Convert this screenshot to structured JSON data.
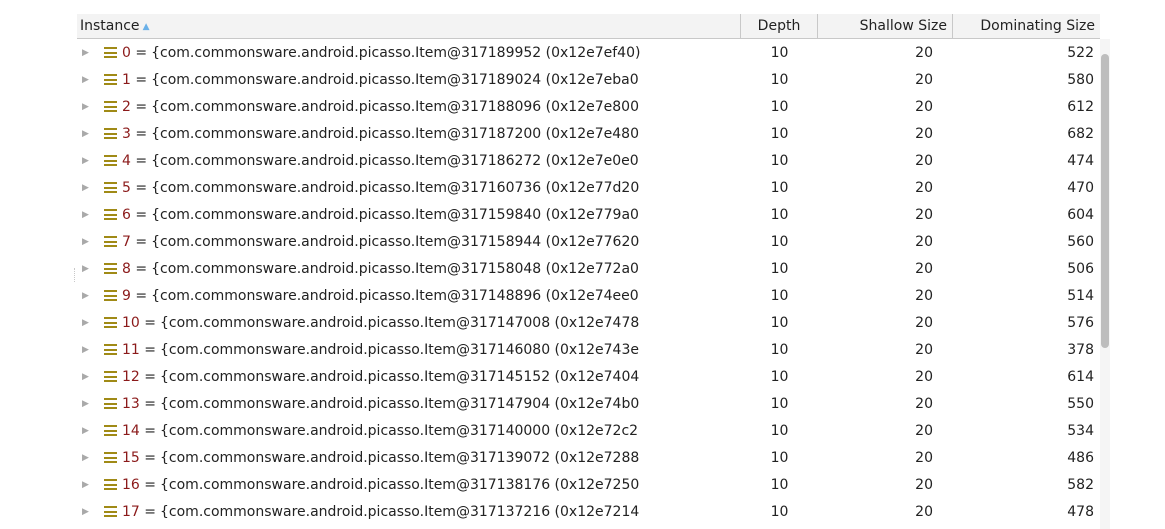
{
  "table": {
    "columns": {
      "instance": "Instance",
      "depth": "Depth",
      "shallow": "Shallow Size",
      "dominating": "Dominating Size"
    },
    "sort_indicator": "▲",
    "rows": [
      {
        "index": "0",
        "value": "{com.commonsware.android.picasso.Item@317189952 (0x12e7ef40)",
        "depth": "10",
        "shallow": "20",
        "dominating": "522"
      },
      {
        "index": "1",
        "value": "{com.commonsware.android.picasso.Item@317189024 (0x12e7eba0",
        "depth": "10",
        "shallow": "20",
        "dominating": "580"
      },
      {
        "index": "2",
        "value": "{com.commonsware.android.picasso.Item@317188096 (0x12e7e800",
        "depth": "10",
        "shallow": "20",
        "dominating": "612"
      },
      {
        "index": "3",
        "value": "{com.commonsware.android.picasso.Item@317187200 (0x12e7e480",
        "depth": "10",
        "shallow": "20",
        "dominating": "682"
      },
      {
        "index": "4",
        "value": "{com.commonsware.android.picasso.Item@317186272 (0x12e7e0e0",
        "depth": "10",
        "shallow": "20",
        "dominating": "474"
      },
      {
        "index": "5",
        "value": "{com.commonsware.android.picasso.Item@317160736 (0x12e77d20",
        "depth": "10",
        "shallow": "20",
        "dominating": "470"
      },
      {
        "index": "6",
        "value": "{com.commonsware.android.picasso.Item@317159840 (0x12e779a0",
        "depth": "10",
        "shallow": "20",
        "dominating": "604"
      },
      {
        "index": "7",
        "value": "{com.commonsware.android.picasso.Item@317158944 (0x12e77620",
        "depth": "10",
        "shallow": "20",
        "dominating": "560"
      },
      {
        "index": "8",
        "value": "{com.commonsware.android.picasso.Item@317158048 (0x12e772a0",
        "depth": "10",
        "shallow": "20",
        "dominating": "506"
      },
      {
        "index": "9",
        "value": "{com.commonsware.android.picasso.Item@317148896 (0x12e74ee0",
        "depth": "10",
        "shallow": "20",
        "dominating": "514"
      },
      {
        "index": "10",
        "value": "{com.commonsware.android.picasso.Item@317147008 (0x12e7478",
        "depth": "10",
        "shallow": "20",
        "dominating": "576"
      },
      {
        "index": "11",
        "value": "{com.commonsware.android.picasso.Item@317146080 (0x12e743e",
        "depth": "10",
        "shallow": "20",
        "dominating": "378"
      },
      {
        "index": "12",
        "value": "{com.commonsware.android.picasso.Item@317145152 (0x12e7404",
        "depth": "10",
        "shallow": "20",
        "dominating": "614"
      },
      {
        "index": "13",
        "value": "{com.commonsware.android.picasso.Item@317147904 (0x12e74b0",
        "depth": "10",
        "shallow": "20",
        "dominating": "550"
      },
      {
        "index": "14",
        "value": "{com.commonsware.android.picasso.Item@317140000 (0x12e72c2",
        "depth": "10",
        "shallow": "20",
        "dominating": "534"
      },
      {
        "index": "15",
        "value": "{com.commonsware.android.picasso.Item@317139072 (0x12e7288",
        "depth": "10",
        "shallow": "20",
        "dominating": "486"
      },
      {
        "index": "16",
        "value": "{com.commonsware.android.picasso.Item@317138176 (0x12e7250",
        "depth": "10",
        "shallow": "20",
        "dominating": "582"
      },
      {
        "index": "17",
        "value": "{com.commonsware.android.picasso.Item@317137216 (0x12e7214",
        "depth": "10",
        "shallow": "20",
        "dominating": "478"
      }
    ]
  },
  "scrollbar": {
    "thumb_start_fraction": 0.03,
    "thumb_visible_fraction": 0.6
  },
  "icons": {
    "expander": "expand-triangle-icon",
    "field": "field-icon"
  },
  "colors": {
    "index_text": "#8b1a1a",
    "field_icon": "#a08a16",
    "sort_arrow": "#6ab0e8"
  }
}
